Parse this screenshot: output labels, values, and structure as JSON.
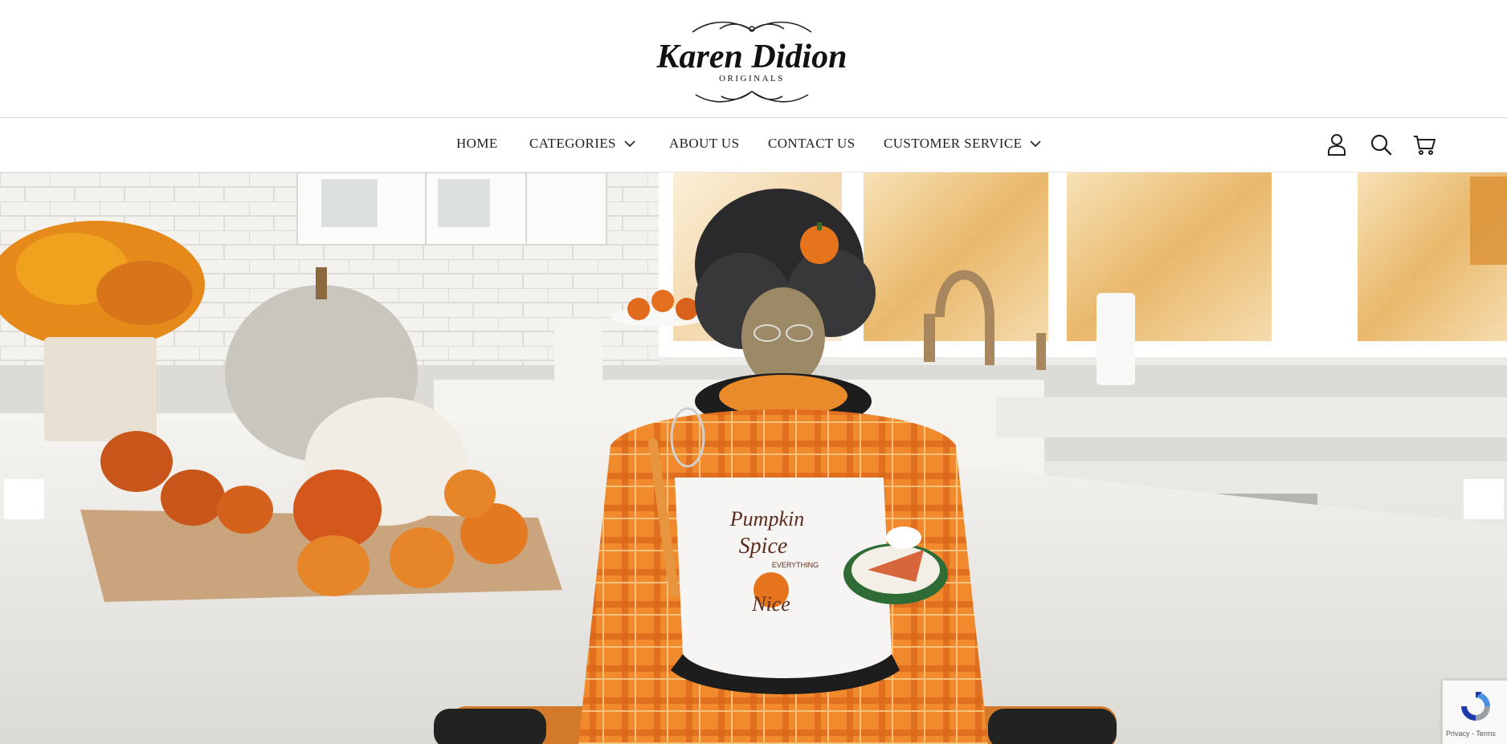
{
  "brand": {
    "name_line1": "Karen Didion",
    "name_line2": "ORIGINALS"
  },
  "nav": {
    "items": [
      {
        "label": "HOME"
      },
      {
        "label": "CATEGORIES"
      },
      {
        "label": "ABOUT US"
      },
      {
        "label": "CONTACT US"
      },
      {
        "label": "CUSTOMER SERVICE"
      }
    ],
    "icons": [
      "account-icon",
      "search-icon",
      "cart-icon"
    ]
  },
  "hero": {
    "apron_text_line1": "Pumpkin",
    "apron_text_line2": "Spice",
    "apron_text_line3": "EVERYTHING",
    "apron_text_line4": "Nice"
  },
  "recaptcha": {
    "links": "Privacy - Terms"
  },
  "colors": {
    "nav_text": "#1e1e1e",
    "accent_orange": "#e07a1f",
    "header_border": "#d9d9d9"
  }
}
